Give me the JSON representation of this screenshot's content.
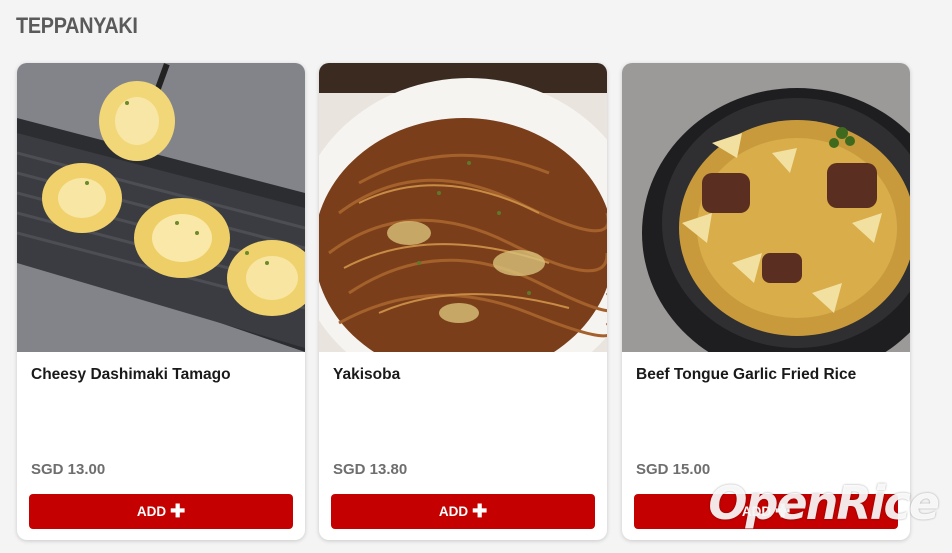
{
  "section": {
    "title": "TEPPANYAKI"
  },
  "items": [
    {
      "name": "Cheesy Dashimaki Tamago",
      "price": "SGD 13.00",
      "button": "ADD",
      "icon": "plus-icon"
    },
    {
      "name": "Yakisoba",
      "price": "SGD 13.80",
      "button": "ADD",
      "icon": "plus-icon"
    },
    {
      "name": "Beef Tongue Garlic Fried Rice",
      "price": "SGD 15.00",
      "button": "ADD",
      "icon": "plus-icon"
    }
  ],
  "watermark": "OpenRice",
  "colors": {
    "accent": "#c40000",
    "price": "#6e6e6e",
    "background": "#f4f4f4"
  }
}
